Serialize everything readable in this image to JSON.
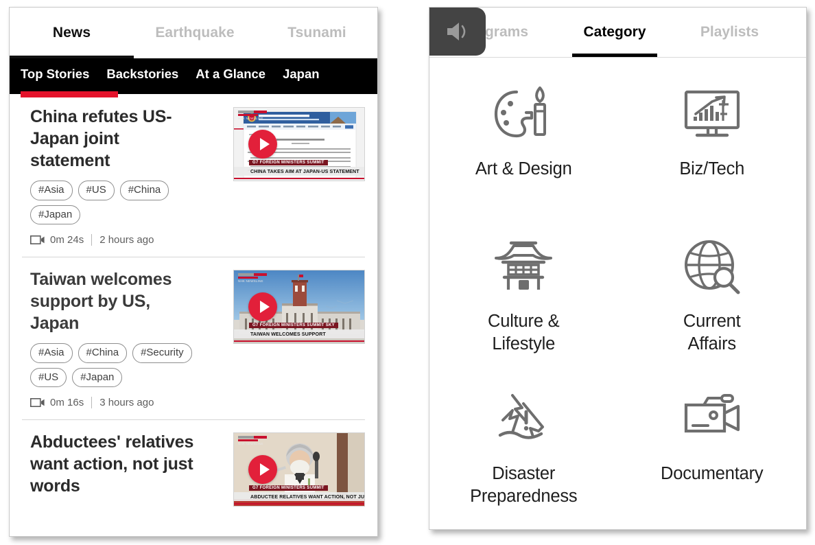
{
  "left_panel": {
    "top_tabs": [
      {
        "label": "News",
        "active": true
      },
      {
        "label": "Earthquake",
        "active": false
      },
      {
        "label": "Tsunami",
        "active": false
      }
    ],
    "sub_nav": [
      {
        "label": "Top Stories",
        "active": true
      },
      {
        "label": "Backstories",
        "active": false
      },
      {
        "label": "At a Glance",
        "active": false
      },
      {
        "label": "Japan",
        "active": false
      }
    ],
    "articles": [
      {
        "title": "China refutes US-Japan joint statement",
        "tags": [
          "#Asia",
          "#US",
          "#China",
          "#Japan"
        ],
        "duration": "0m 24s",
        "published": "2 hours ago",
        "thumbnail_caption": "CHINA TAKES AIM AT JAPAN-US STATEMENT",
        "thumbnail_badge": "G7 FOREIGN MINISTERS SUMMIT",
        "channel_label": "NHK NEWSLINE"
      },
      {
        "title": "Taiwan welcomes support by US, Japan",
        "tags": [
          "#Asia",
          "#China",
          "#Security",
          "#US",
          "#Japan"
        ],
        "duration": "0m 16s",
        "published": "3 hours ago",
        "thumbnail_caption": "TAIWAN WELCOMES SUPPORT",
        "thumbnail_badge": "G7 FOREIGN MINISTERS SUMMIT  SKY",
        "channel_label": "NHK NEWSLINE"
      },
      {
        "title": "Abductees' relatives want action, not just words",
        "tags": [],
        "duration": "",
        "published": "",
        "thumbnail_caption": "ABDUCTEE RELATIVES WANT ACTION, NOT JUST WORDS",
        "thumbnail_badge": "G7 FOREIGN MINISTERS SUMMIT",
        "channel_label": "NHK NEWSLINE"
      }
    ]
  },
  "right_panel": {
    "speaker_icon": "speaker-volume-icon",
    "tabs": [
      {
        "label": "Programs",
        "active": false
      },
      {
        "label": "Category",
        "active": true
      },
      {
        "label": "Playlists",
        "active": false
      }
    ],
    "categories": [
      {
        "label": "Art & Design",
        "icon": "palette-brush-icon"
      },
      {
        "label": "Biz/Tech",
        "icon": "monitor-chart-icon"
      },
      {
        "label": "Culture &\nLifestyle",
        "icon": "temple-icon"
      },
      {
        "label": "Current\nAffairs",
        "icon": "globe-search-icon"
      },
      {
        "label": "Disaster\nPreparedness",
        "icon": "damaged-house-alert-icon"
      },
      {
        "label": "Documentary",
        "icon": "video-camera-icon"
      }
    ]
  },
  "colors": {
    "accent_red": "#e4122b",
    "play_button_red": "#e2203a",
    "subnav_black": "#000000",
    "icon_gray": "#6e6e6e",
    "inactive_tab_gray": "#bdbdbd"
  }
}
